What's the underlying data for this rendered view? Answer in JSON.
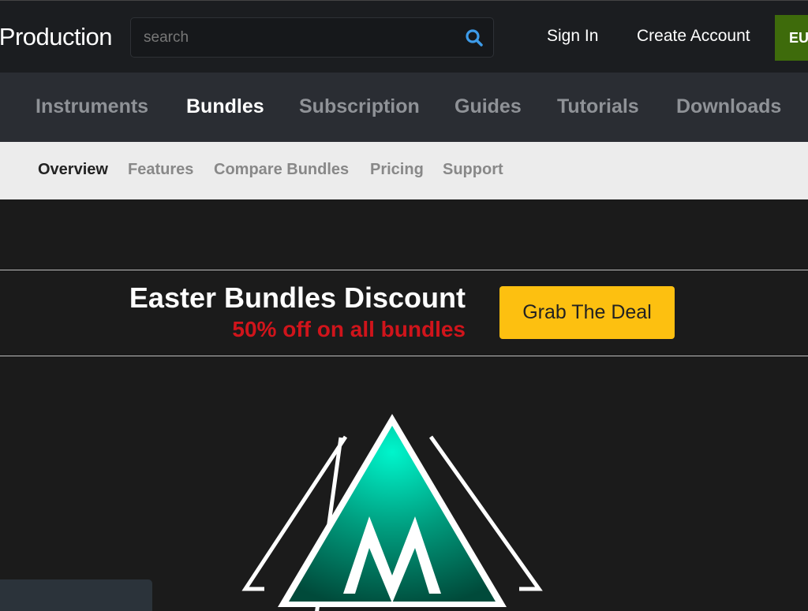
{
  "header": {
    "logo_text": "Production",
    "search_placeholder": "search",
    "sign_in": "Sign In",
    "create_account": "Create Account",
    "currency": "EU"
  },
  "nav": {
    "items": [
      {
        "label": "Instruments"
      },
      {
        "label": "Bundles",
        "active": true
      },
      {
        "label": "Subscription"
      },
      {
        "label": "Guides"
      },
      {
        "label": "Tutorials"
      },
      {
        "label": "Downloads"
      }
    ]
  },
  "subnav": {
    "items": [
      {
        "label": "Overview",
        "active": true
      },
      {
        "label": "Features"
      },
      {
        "label": "Compare Bundles"
      },
      {
        "label": "Pricing"
      },
      {
        "label": "Support"
      }
    ]
  },
  "banner": {
    "title": "Easter Bundles Discount",
    "subtitle": "50% off on all bundles",
    "button": "Grab The Deal"
  },
  "colors": {
    "accent_button": "#fdc010",
    "discount_red": "#d0141b",
    "currency_green": "#3e6b0b",
    "search_icon": "#3d9be9",
    "logo_teal": "#00e5c0"
  },
  "icons": {
    "search": "search-icon",
    "logo": "mountain-m-logo"
  }
}
